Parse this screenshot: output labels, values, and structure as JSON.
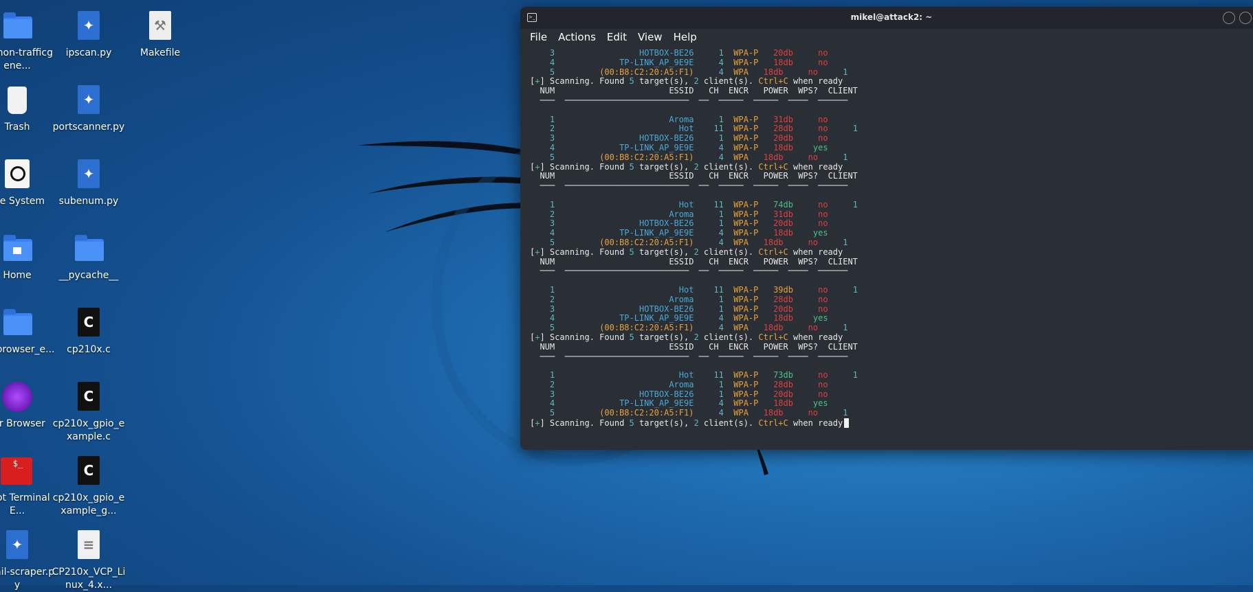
{
  "colors": {
    "terminal_bg": "#2a2e35",
    "cyan": "#5fb8c4",
    "essid_blue": "#4aa9d6",
    "orange": "#e8a23c",
    "red": "#e04040",
    "green": "#4fc08a"
  },
  "desktop": {
    "col1": [
      {
        "label": "python-trafficgene...",
        "icon": "folder-icon"
      },
      {
        "label": "Trash",
        "icon": "trash-icon"
      },
      {
        "label": "File System",
        "icon": "drive-icon"
      },
      {
        "label": "Home",
        "icon": "home-folder-icon"
      },
      {
        "label": "tor-browser_e...",
        "icon": "folder-icon"
      },
      {
        "label": "Tor Browser",
        "icon": "tor-icon"
      },
      {
        "label": "Root Terminal E...",
        "icon": "root-terminal-icon"
      },
      {
        "label": "email-scraper.py",
        "icon": "python-file-icon"
      }
    ],
    "col2": [
      {
        "label": "ipscan.py",
        "icon": "python-file-icon"
      },
      {
        "label": "portscanner.py",
        "icon": "python-file-icon"
      },
      {
        "label": "subenum.py",
        "icon": "python-file-icon"
      },
      {
        "label": "__pycache__",
        "icon": "folder-icon"
      },
      {
        "label": "cp210x.c",
        "icon": "c-file-icon"
      },
      {
        "label": "cp210x_gpio_example.c",
        "icon": "c-file-icon"
      },
      {
        "label": "cp210x_gpio_example_g...",
        "icon": "c-file-icon"
      },
      {
        "label": "CP210x_VCP_Linux_4.x...",
        "icon": "text-file-icon"
      }
    ],
    "col3": [
      {
        "label": "Makefile",
        "icon": "makefile-icon"
      }
    ]
  },
  "terminal": {
    "title": "mikel@attack2: ~",
    "menu": [
      "File",
      "Actions",
      "Edit",
      "View",
      "Help"
    ],
    "header": {
      "num": "NUM",
      "essid": "ESSID",
      "ch": "CH",
      "encr": "ENCR",
      "power": "POWER",
      "wps": "WPS?",
      "client": "CLIENT"
    },
    "scan_line": {
      "prefix": "[",
      "plus": "+",
      "suffix": "] Scanning. Found ",
      "targets": "5",
      "mid": " target(s), ",
      "clients": "2",
      "mid2": " client(s). ",
      "ctrl": "Ctrl+C",
      "end": " when ready"
    },
    "initial_rows": [
      {
        "num": "3",
        "essid": "HOTBOX-BE26",
        "ch": "1",
        "encr": "WPA-P",
        "power": "20db",
        "pc": "red",
        "wps": "no",
        "wc": "red",
        "client": ""
      },
      {
        "num": "4",
        "essid": "TP-LINK_AP_9E9E",
        "ch": "4",
        "encr": "WPA-P",
        "power": "18db",
        "pc": "red",
        "wps": "no",
        "wc": "red",
        "client": ""
      },
      {
        "num": "5",
        "essid": "(00:B8:C2:20:A5:F1)",
        "mac": true,
        "ch": "4",
        "encr": "WPA",
        "power": "18db",
        "pc": "red",
        "wps": "no",
        "wc": "red",
        "client": "1"
      }
    ],
    "blocks": [
      [
        {
          "num": "1",
          "essid": "Aroma",
          "ch": "1",
          "encr": "WPA-P",
          "power": "31db",
          "pc": "red",
          "wps": "no",
          "wc": "red",
          "client": ""
        },
        {
          "num": "2",
          "essid": "Hot",
          "ch": "11",
          "encr": "WPA-P",
          "power": "28db",
          "pc": "red",
          "wps": "no",
          "wc": "red",
          "client": "1"
        },
        {
          "num": "3",
          "essid": "HOTBOX-BE26",
          "ch": "1",
          "encr": "WPA-P",
          "power": "20db",
          "pc": "red",
          "wps": "no",
          "wc": "red",
          "client": ""
        },
        {
          "num": "4",
          "essid": "TP-LINK_AP_9E9E",
          "ch": "4",
          "encr": "WPA-P",
          "power": "18db",
          "pc": "red",
          "wps": "yes",
          "wc": "green",
          "client": ""
        },
        {
          "num": "5",
          "essid": "(00:B8:C2:20:A5:F1)",
          "mac": true,
          "ch": "4",
          "encr": "WPA",
          "power": "18db",
          "pc": "red",
          "wps": "no",
          "wc": "red",
          "client": "1"
        }
      ],
      [
        {
          "num": "1",
          "essid": "Hot",
          "ch": "11",
          "encr": "WPA-P",
          "power": "74db",
          "pc": "green",
          "wps": "no",
          "wc": "red",
          "client": "1"
        },
        {
          "num": "2",
          "essid": "Aroma",
          "ch": "1",
          "encr": "WPA-P",
          "power": "31db",
          "pc": "red",
          "wps": "no",
          "wc": "red",
          "client": ""
        },
        {
          "num": "3",
          "essid": "HOTBOX-BE26",
          "ch": "1",
          "encr": "WPA-P",
          "power": "20db",
          "pc": "red",
          "wps": "no",
          "wc": "red",
          "client": ""
        },
        {
          "num": "4",
          "essid": "TP-LINK_AP_9E9E",
          "ch": "4",
          "encr": "WPA-P",
          "power": "18db",
          "pc": "red",
          "wps": "yes",
          "wc": "green",
          "client": ""
        },
        {
          "num": "5",
          "essid": "(00:B8:C2:20:A5:F1)",
          "mac": true,
          "ch": "4",
          "encr": "WPA",
          "power": "18db",
          "pc": "red",
          "wps": "no",
          "wc": "red",
          "client": "1"
        }
      ],
      [
        {
          "num": "1",
          "essid": "Hot",
          "ch": "11",
          "encr": "WPA-P",
          "power": "39db",
          "pc": "orange",
          "wps": "no",
          "wc": "red",
          "client": "1"
        },
        {
          "num": "2",
          "essid": "Aroma",
          "ch": "1",
          "encr": "WPA-P",
          "power": "28db",
          "pc": "red",
          "wps": "no",
          "wc": "red",
          "client": ""
        },
        {
          "num": "3",
          "essid": "HOTBOX-BE26",
          "ch": "1",
          "encr": "WPA-P",
          "power": "20db",
          "pc": "red",
          "wps": "no",
          "wc": "red",
          "client": ""
        },
        {
          "num": "4",
          "essid": "TP-LINK_AP_9E9E",
          "ch": "4",
          "encr": "WPA-P",
          "power": "18db",
          "pc": "red",
          "wps": "yes",
          "wc": "green",
          "client": ""
        },
        {
          "num": "5",
          "essid": "(00:B8:C2:20:A5:F1)",
          "mac": true,
          "ch": "4",
          "encr": "WPA",
          "power": "18db",
          "pc": "red",
          "wps": "no",
          "wc": "red",
          "client": "1"
        }
      ],
      [
        {
          "num": "1",
          "essid": "Hot",
          "ch": "11",
          "encr": "WPA-P",
          "power": "73db",
          "pc": "green",
          "wps": "no",
          "wc": "red",
          "client": "1"
        },
        {
          "num": "2",
          "essid": "Aroma",
          "ch": "1",
          "encr": "WPA-P",
          "power": "28db",
          "pc": "red",
          "wps": "no",
          "wc": "red",
          "client": ""
        },
        {
          "num": "3",
          "essid": "HOTBOX-BE26",
          "ch": "1",
          "encr": "WPA-P",
          "power": "20db",
          "pc": "red",
          "wps": "no",
          "wc": "red",
          "client": ""
        },
        {
          "num": "4",
          "essid": "TP-LINK_AP_9E9E",
          "ch": "4",
          "encr": "WPA-P",
          "power": "18db",
          "pc": "red",
          "wps": "yes",
          "wc": "green",
          "client": ""
        },
        {
          "num": "5",
          "essid": "(00:B8:C2:20:A5:F1)",
          "mac": true,
          "ch": "4",
          "encr": "WPA",
          "power": "18db",
          "pc": "red",
          "wps": "no",
          "wc": "red",
          "client": "1"
        }
      ]
    ]
  }
}
